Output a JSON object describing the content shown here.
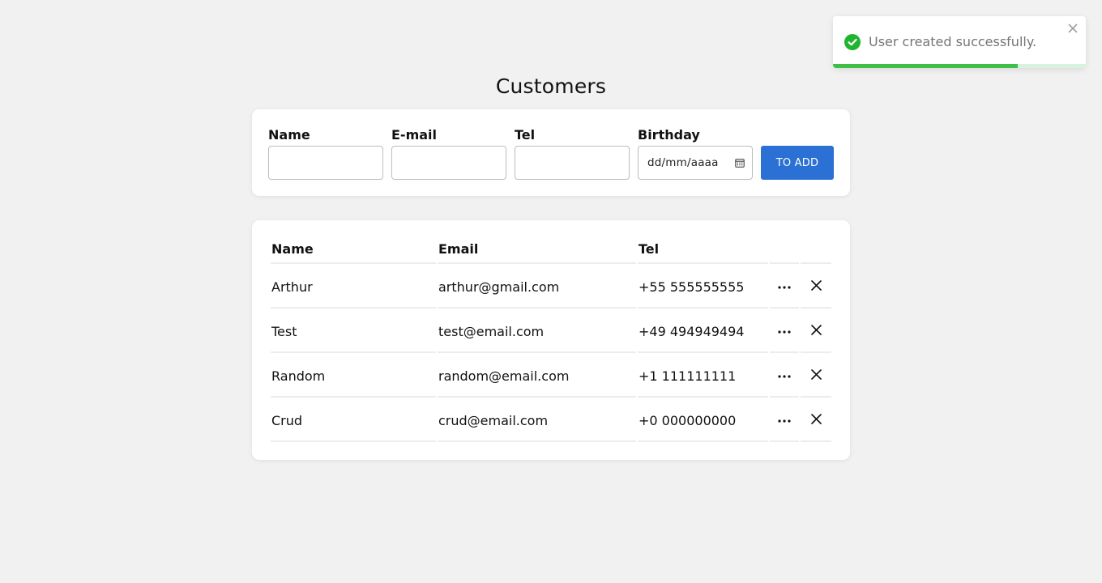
{
  "page": {
    "title": "Customers"
  },
  "form": {
    "name_label": "Name",
    "name_value": "",
    "email_label": "E-mail",
    "email_value": "",
    "tel_label": "Tel",
    "tel_value": "",
    "birthday_label": "Birthday",
    "birthday_placeholder": "dd/mm/aaaa",
    "submit_label": "TO ADD"
  },
  "table": {
    "headers": [
      "Name",
      "Email",
      "Tel"
    ],
    "rows": [
      {
        "name": "Arthur",
        "email": "arthur@gmail.com",
        "tel": "+55 555555555"
      },
      {
        "name": "Test",
        "email": "test@email.com",
        "tel": "+49 494949494"
      },
      {
        "name": "Random",
        "email": "random@email.com",
        "tel": "+1 111111111"
      },
      {
        "name": "Crud",
        "email": "crud@email.com",
        "tel": "+0 000000000"
      }
    ],
    "row_actions": [
      "more-icon",
      "close-icon"
    ]
  },
  "toast": {
    "message": "User created successfully.",
    "icon": "check-circle-icon",
    "progress": 0.73
  },
  "colors": {
    "background": "#f1f1f1",
    "primary": "#2b70d4",
    "success": "#3fbf48",
    "success_track": "#d8f3dd",
    "toast_text": "#757575"
  }
}
